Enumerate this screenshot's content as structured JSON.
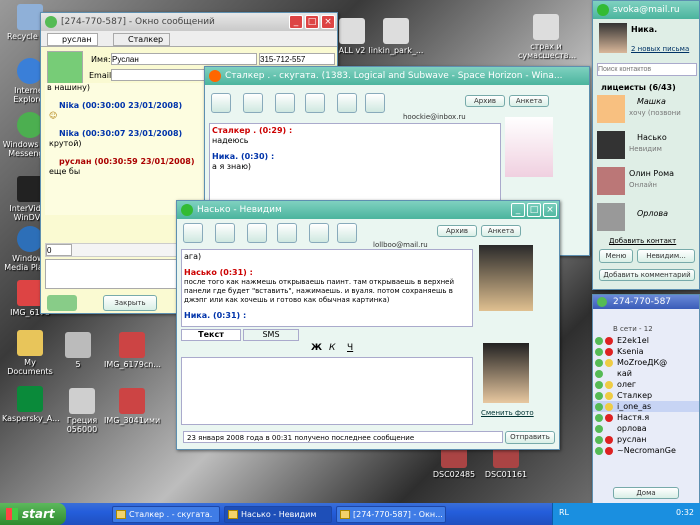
{
  "desktop": {
    "icons": [
      {
        "label": "Recycle Bin"
      },
      {
        "label": "Internet Explorer"
      },
      {
        "label": "Windows Live Messenger"
      },
      {
        "label": "InterVideo WinDVD"
      },
      {
        "label": "Windows Media Player"
      },
      {
        "label": "IMG_6178"
      },
      {
        "label": "My Documents"
      },
      {
        "label": "Kaspersky_A..."
      },
      {
        "label": "Греция 056000"
      },
      {
        "label": "IMG_3041ими"
      },
      {
        "label": "IMG_6179cn..."
      },
      {
        "label": "5"
      },
      {
        "label": "ALL v2"
      },
      {
        "label": "linkin_park_..."
      },
      {
        "label": "страх и сумасшеств..."
      },
      {
        "label": "DSC02485"
      },
      {
        "label": "DSC01161"
      }
    ]
  },
  "win1": {
    "title": "[274-770-587] - Окно сообщений",
    "tabs": [
      "руслан",
      "Сталкер"
    ],
    "name_label": "Имя:",
    "name_value": "Руслан",
    "phone": "315-712-557",
    "email_label": "Email",
    "partial": "в нашину)",
    "messages": [
      {
        "head": "Nika (00:30:00 23/01/2008)",
        "text": "☺"
      },
      {
        "head": "Nika (00:30:07 23/01/2008)",
        "text": "крутой)"
      },
      {
        "head": "руслан (00:30:59 23/01/2008)",
        "text": "еще бы"
      }
    ],
    "input_value": "0",
    "close_label": "Закрыть"
  },
  "win2": {
    "title": "Сталкер . - скугата. (1383. Logical and Subwave - Space Horizon - Wina...",
    "archive": "Архив",
    "profile": "Анкета",
    "email": "hoockie@inbox.ru",
    "messages": [
      {
        "head": "Сталкер . (0:29) :",
        "text": "надеюсь"
      },
      {
        "head": "Ника. (0:30) :",
        "text": "а я знаю)"
      }
    ]
  },
  "win3": {
    "title": "Насько - Невидим",
    "archive": "Архив",
    "profile": "Анкета",
    "email": "lollboo@mail.ru",
    "messages": [
      {
        "head": "",
        "text": "ага)"
      },
      {
        "head": "Насько (0:31) :",
        "text": "после того как нажмешь открываешь паинт. там открываешь в верхней панели где будет \"вставить\", нажимаешь. и вуаля. потом сохраняешь в джэпг или как хочешь и готово как обычная картинка)"
      },
      {
        "head": "Ника. (0:31) :",
        "text": ""
      }
    ],
    "tab_text": "Текст",
    "tab_sms": "SMS",
    "fmt": [
      "Ж",
      "К",
      "Ч"
    ],
    "change_photo": "Сменить фото",
    "status": "23 января 2008 года в 00:31 получено последнее сообщение",
    "send": "Отправить"
  },
  "agent": {
    "email": "svoka@mail.ru",
    "name": "Ника.",
    "letters": "2 новых письма",
    "search_placeholder": "Поиск контактов",
    "group": "лицеисты (6/43)",
    "contacts": [
      {
        "name": "Машка",
        "status": "хочу (позвони"
      },
      {
        "name": "Насько",
        "status": "Невидим"
      },
      {
        "name": "Олин Рома",
        "status": "Онлайн"
      },
      {
        "name": "Орлова",
        "status": ""
      }
    ],
    "add_contact": "Добавить контакт",
    "menu": "Меню",
    "invisible": "Невидим...",
    "add_comment": "Добавить комментарий"
  },
  "icq": {
    "title": "274-770-587",
    "online_label": "В сети - 12",
    "contacts": [
      "E2ek1el",
      "Ksenia",
      "MoZroeДК@",
      "кай",
      "олег",
      "Сталкер",
      "i_one_as",
      "Настя.я",
      "орлова",
      "руслан",
      "~NecromanGe"
    ],
    "home": "Дома"
  },
  "taskbar": {
    "start": "start",
    "tasks": [
      "Сталкер . - скугата.",
      "Насько - Невидим",
      "[274-770-587] - Окн..."
    ],
    "lang": "RL",
    "clock": "0:32"
  }
}
